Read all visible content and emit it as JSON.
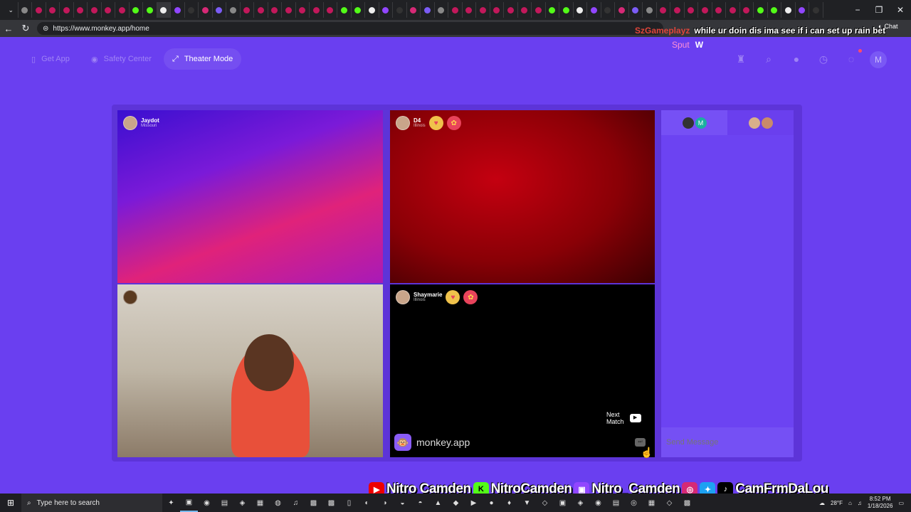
{
  "browser": {
    "url": "https://www.monkey.app/home",
    "tab_count": 58,
    "window_controls": [
      "−",
      "❐",
      "✕"
    ]
  },
  "stream_overlay": {
    "chat_user": "SzGameplayz",
    "chat_message": "while ur doin dis ima see if i can set up rain bet",
    "chat_user2": "Sput",
    "chat_message2": "W",
    "chat_label": "Chat"
  },
  "app_header": {
    "get_app": "Get App",
    "safety_center": "Safety Center",
    "theater_mode": "Theater Mode",
    "avatar_letter": "M"
  },
  "tiles": [
    {
      "name": "Jaydot",
      "location": "Missouri"
    },
    {
      "name": "D4",
      "location": "Illinois"
    },
    {
      "name": "",
      "location": ""
    },
    {
      "name": "Shaymarie",
      "location": "Illinois"
    }
  ],
  "controls": {
    "next_match_line1": "Next",
    "next_match_line2": "Match",
    "brand": "monkey.app"
  },
  "chat_panel": {
    "tab1_avatar_letter": "M",
    "send_placeholder": "Send Message"
  },
  "social_bar": {
    "youtube": "Nitro Camden",
    "kick": "NitroCamden",
    "twitch": "Nitro_Camden",
    "others": "CamFrmDaLou"
  },
  "taskbar": {
    "search_placeholder": "Type here to search",
    "weather": "28°F",
    "time": "8:52 PM",
    "date": "1/18/2026"
  },
  "colors": {
    "app_bg": "#6a3ff0",
    "stage_bg": "#5d34d8",
    "chat_panel": "#6c43f2",
    "overlay_user": "#e0453a"
  }
}
